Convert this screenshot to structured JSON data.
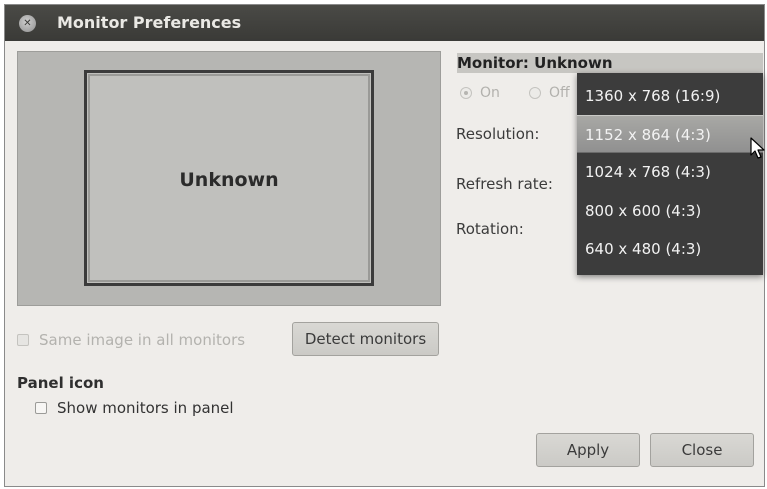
{
  "window": {
    "title": "Monitor Preferences"
  },
  "preview": {
    "monitor_name": "Unknown"
  },
  "same_image": {
    "label": "Same image in all monitors",
    "checked": false,
    "enabled": false
  },
  "detect_button": {
    "label": "Detect monitors"
  },
  "monitor_panel": {
    "header": "Monitor: Unknown",
    "on_label": "On",
    "off_label": "Off",
    "power": "on",
    "resolution_label": "Resolution:",
    "refresh_label": "Refresh rate:",
    "rotation_label": "Rotation:"
  },
  "resolution_dropdown": {
    "options": [
      "1360 x 768 (16:9)",
      "1152 x 864 (4:3)",
      "1024 x 768 (4:3)",
      "800 x 600 (4:3)",
      "640 x 480 (4:3)"
    ],
    "highlighted": "1152 x 864 (4:3)"
  },
  "panel_icon": {
    "title": "Panel icon",
    "show_label": "Show monitors in panel",
    "checked": false
  },
  "buttons": {
    "apply": "Apply",
    "close": "Close"
  },
  "icons": {
    "close": "close-icon",
    "cursor": "mouse-pointer-icon"
  }
}
